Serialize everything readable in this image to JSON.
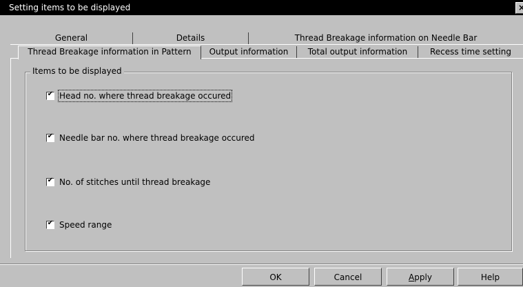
{
  "window": {
    "title": "Setting items to be displayed",
    "close_label": "×"
  },
  "tabs": {
    "row1": [
      {
        "label": "General"
      },
      {
        "label": "Details"
      },
      {
        "label": "Thread Breakage information on Needle Bar"
      }
    ],
    "row2": [
      {
        "label": "Thread Breakage information in Pattern",
        "selected": true
      },
      {
        "label": "Output information"
      },
      {
        "label": "Total output information"
      },
      {
        "label": "Recess time setting"
      }
    ]
  },
  "group": {
    "legend": "Items to be displayed",
    "items": [
      {
        "label": "Head no. where thread breakage occured",
        "checked": true
      },
      {
        "label": "Needle bar no. where thread breakage occured",
        "checked": true
      },
      {
        "label": "No. of stitches until thread breakage",
        "checked": true
      },
      {
        "label": "Speed range",
        "checked": true
      }
    ],
    "check_glyph": "✔"
  },
  "buttons": {
    "ok": "OK",
    "cancel": "Cancel",
    "apply_prefix": "A",
    "apply_rest": "pply",
    "help": "Help"
  }
}
